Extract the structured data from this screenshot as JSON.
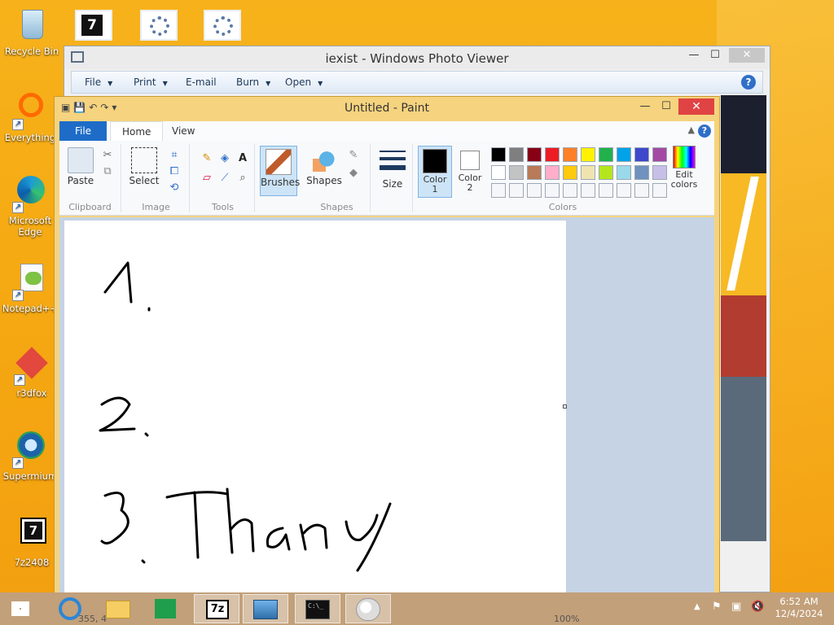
{
  "desktop": {
    "icons": [
      {
        "label": "Recycle Bin"
      },
      {
        "label": "Everything"
      },
      {
        "label": "Microsoft Edge"
      },
      {
        "label": "Notepad++"
      },
      {
        "label": "r3dfox"
      },
      {
        "label": "Supermium"
      },
      {
        "label": "7z2408"
      }
    ]
  },
  "photo_viewer": {
    "title": "iexist - Windows Photo Viewer",
    "menu": [
      {
        "label": "File"
      },
      {
        "label": "Print"
      },
      {
        "label": "E-mail"
      },
      {
        "label": "Burn"
      },
      {
        "label": "Open"
      }
    ],
    "help": "?"
  },
  "paint": {
    "title": "Untitled - Paint",
    "tabs": {
      "file": "File",
      "home": "Home",
      "view": "View"
    },
    "groups": {
      "clipboard": "Clipboard",
      "image": "Image",
      "tools": "Tools",
      "shapes": "Shapes",
      "colors": "Colors"
    },
    "buttons": {
      "paste": "Paste",
      "select": "Select",
      "brushes": "Brushes",
      "shapes": "Shapes",
      "size": "Size",
      "color1": "Color 1",
      "color2": "Color 2",
      "edit_colors": "Edit colors"
    },
    "palette_row1": [
      "#000000",
      "#7f7f7f",
      "#880015",
      "#ed1c24",
      "#ff7f27",
      "#fff200",
      "#22b14c",
      "#00a2e8",
      "#3f48cc",
      "#a349a4"
    ],
    "palette_row2": [
      "#ffffff",
      "#c3c3c3",
      "#b97a57",
      "#ffaec9",
      "#ffc90e",
      "#efe4b0",
      "#b5e61d",
      "#99d9ea",
      "#7092be",
      "#c8bfe7"
    ],
    "color1_value": "#000000",
    "color2_value": "#ffffff",
    "canvas_text": [
      "1.",
      "2.",
      "3. Thany"
    ],
    "status": {
      "cursor_pos": "355, 4",
      "zoom": "100%"
    }
  },
  "taskbar": {
    "time": "6:52 AM",
    "date": "12/4/2024"
  }
}
